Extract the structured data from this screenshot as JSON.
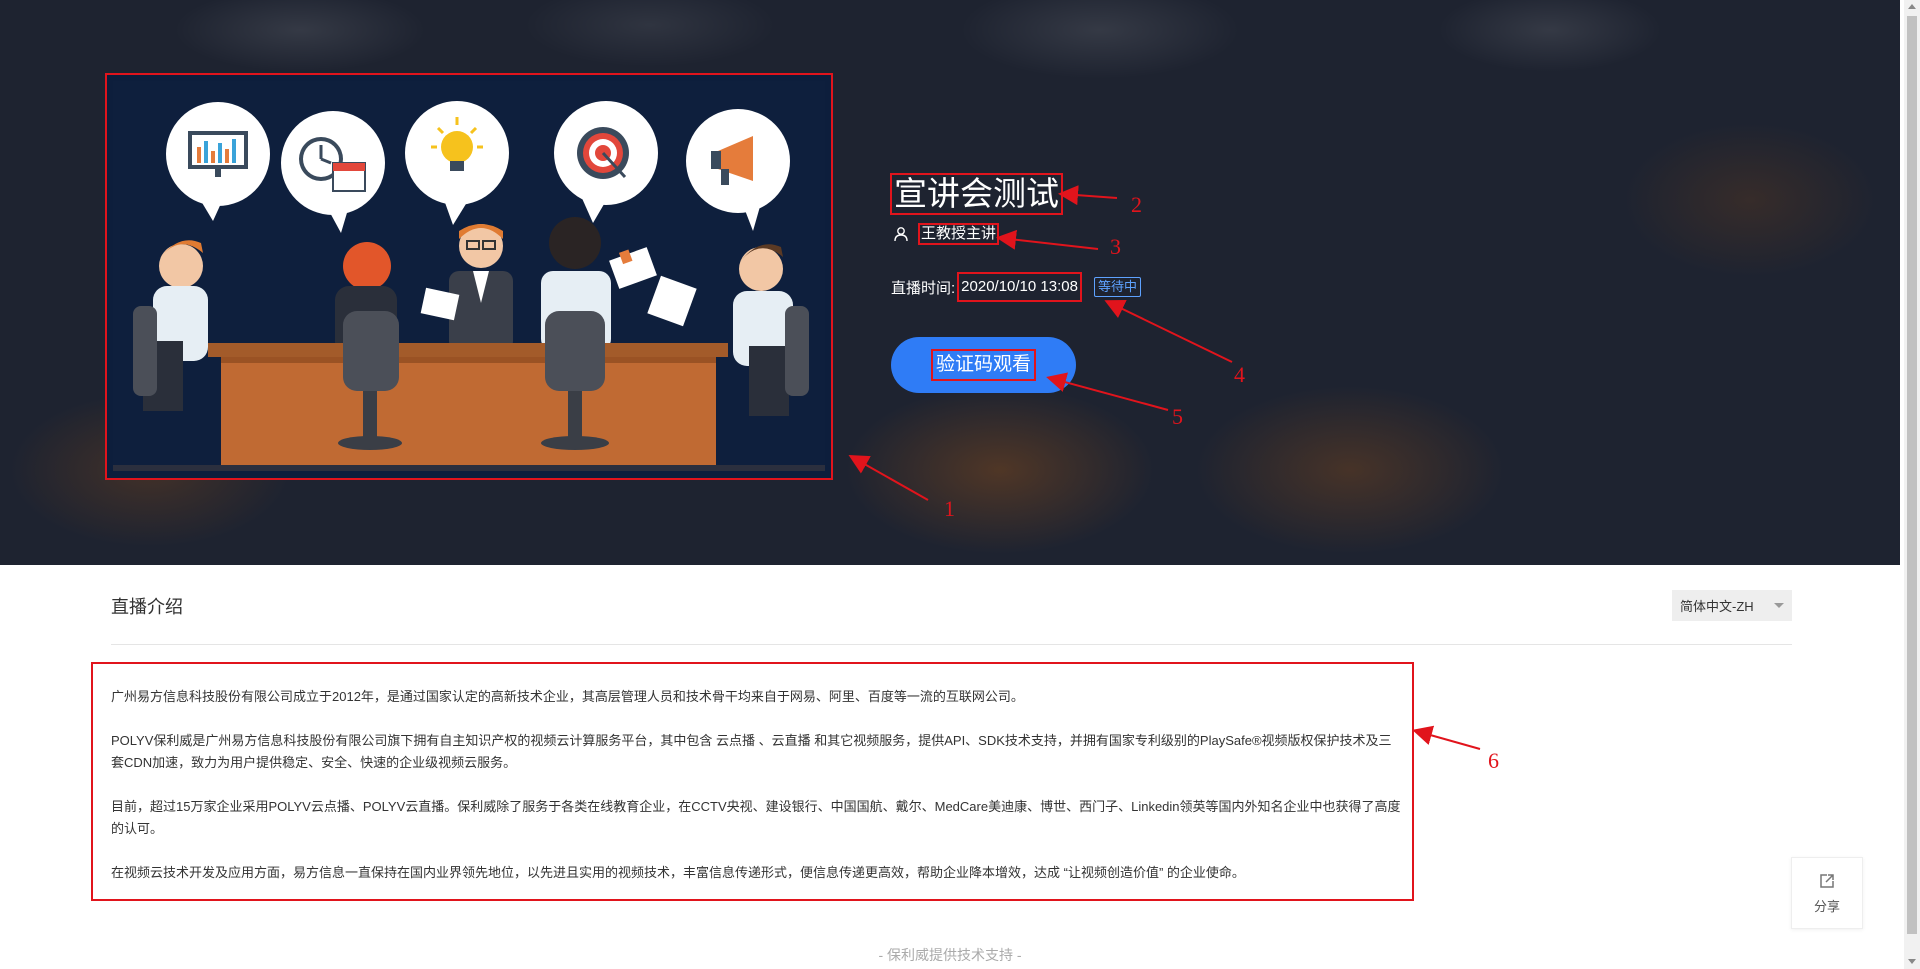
{
  "hero": {
    "title": "宣讲会测试",
    "presenter": "王教授主讲",
    "time_label": "直播时间:",
    "time_value": "2020/10/10 13:08",
    "status": "等待中",
    "watch_button": "验证码观看",
    "accent_color": "#2f7cf6",
    "annotation_color": "#e1141c",
    "icons": [
      "person-icon"
    ]
  },
  "cover": {
    "description_icons": [
      "chart-icon",
      "clock-calendar-icon",
      "lightbulb-icon",
      "target-icon",
      "megaphone-icon"
    ]
  },
  "annotations": [
    "1",
    "2",
    "3",
    "4",
    "5",
    "6"
  ],
  "intro": {
    "title": "直播介绍",
    "language": "简体中文-ZH",
    "paragraphs": [
      "广州易方信息科技股份有限公司成立于2012年，是通过国家认定的高新技术企业，其高层管理人员和技术骨干均来自于网易、阿里、百度等一流的互联网公司。",
      "POLYV保利威是广州易方信息科技股份有限公司旗下拥有自主知识产权的视频云计算服务平台，其中包含 云点播 、云直播 和其它视频服务，提供API、SDK技术支持，并拥有国家专利级别的PlaySafe®视频版权保护技术及三套CDN加速，致力为用户提供稳定、安全、快速的企业级视频云服务。",
      "目前，超过15万家企业采用POLYV云点播、POLYV云直播。保利威除了服务于各类在线教育企业，在CCTV央视、建设银行、中国国航、戴尔、MedCare美迪康、博世、西门子、Linkedin领英等国内外知名企业中也获得了高度的认可。",
      "在视频云技术开发及应用方面，易方信息一直保持在国内业界领先地位，以先进且实用的视频技术，丰富信息传递形式，便信息传递更高效，帮助企业降本增效，达成 “让视频创造价值” 的企业使命。"
    ]
  },
  "share": {
    "label": "分享"
  },
  "footer": {
    "text": "- 保利威提供技术支持 -"
  }
}
